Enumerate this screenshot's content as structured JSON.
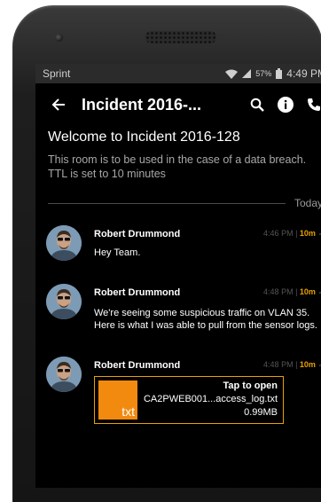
{
  "status_bar": {
    "carrier": "Sprint",
    "battery_percent": "57%",
    "time": "4:49 PM"
  },
  "app_bar": {
    "title": "Incident 2016-..."
  },
  "room": {
    "welcome_title": "Welcome to Incident 2016-128",
    "description": "This room is to be used in the case of a data breach. TTL is set to 10 minutes"
  },
  "divider": {
    "label": "Today"
  },
  "messages": [
    {
      "sender": "Robert Drummond",
      "time": "4:46 PM",
      "ttl": "10m",
      "text": "Hey Team."
    },
    {
      "sender": "Robert Drummond",
      "time": "4:48 PM",
      "ttl": "10m",
      "text_lines": [
        "We're seeing some suspicious traffic on VLAN 35.",
        "Here is what I was able to pull from the sensor logs."
      ]
    },
    {
      "sender": "Robert Drummond",
      "time": "4:48 PM",
      "ttl": "10m",
      "attachment": {
        "action": "Tap to open",
        "filename": "CA2PWEB001...access_log.txt",
        "size": "0.99MB",
        "ext": "txt"
      }
    }
  ],
  "colors": {
    "accent": "#e8a000",
    "file_icon": "#f28a10",
    "background": "#000000"
  }
}
